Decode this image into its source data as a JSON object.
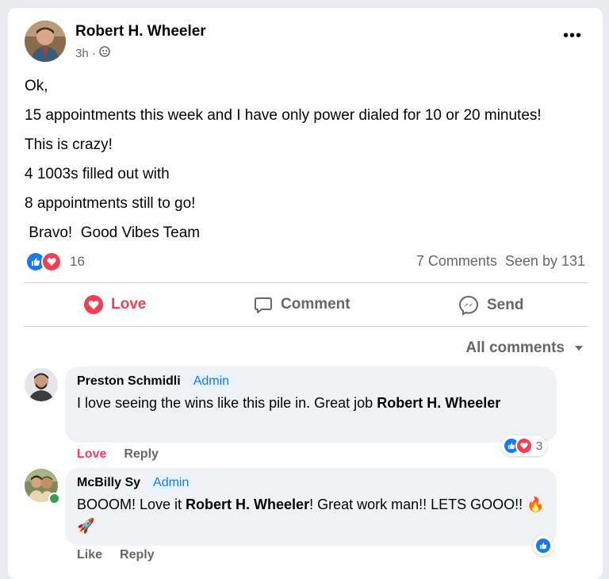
{
  "post": {
    "author": "Robert H. Wheeler",
    "time": "3h",
    "separator": "·",
    "more_label": "•••",
    "body": [
      "Ok,",
      "15 appointments this week and I have only power dialed for 10 or 20 minutes!",
      "This is crazy!",
      "4 1003s filled out with",
      "8 appointments still to go!",
      " Bravo!  Good Vibes Team"
    ],
    "reaction_count": "16",
    "comments_count": "7 Comments",
    "seen_by": "Seen by 131"
  },
  "actions": {
    "love": "Love",
    "comment": "Comment",
    "send": "Send"
  },
  "filter": {
    "label": "All comments"
  },
  "comments": [
    {
      "name": "Preston Schmidli",
      "badge": "Admin",
      "text_before": "I love seeing the wins like this pile in. Great job ",
      "mention": "Robert H. Wheeler",
      "text_after": "",
      "action1": "Love",
      "action2": "Reply",
      "reaction_count": "3"
    },
    {
      "name": "McBilly Sy",
      "badge": "Admin",
      "text_before": "BOOOM! Love it ",
      "mention": "Robert H. Wheeler",
      "text_after": "! Great work man!! LETS GOOO!! 🔥🚀",
      "action1": "Like",
      "action2": "Reply"
    }
  ],
  "colors": {
    "like_blue": "#1877f2",
    "love_red": "#f33e58",
    "secondary_text": "#65676b"
  }
}
